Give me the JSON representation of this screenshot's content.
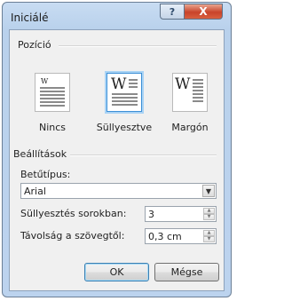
{
  "window": {
    "title": "Iniciálé",
    "help_symbol": "?",
    "close_symbol": "X"
  },
  "position": {
    "group_label": "Pozíció",
    "options": [
      {
        "label": "Nincs",
        "selected": false
      },
      {
        "label": "Süllyesztve",
        "selected": true
      },
      {
        "label": "Margón",
        "selected": false
      }
    ],
    "drop_letter": "W"
  },
  "settings": {
    "group_label": "Beállítások",
    "font_label": "Betűtípus:",
    "font_value": "Arial",
    "lines_label": "Süllyesztés sorokban:",
    "lines_value": "3",
    "distance_label": "Távolság a szövegtől:",
    "distance_value": "0,3 cm"
  },
  "buttons": {
    "ok": "OK",
    "cancel": "Mégse"
  },
  "colors": {
    "selection_border": "#3d8fd6",
    "close_button": "#c9442a",
    "title_bar": "#b9d1ec"
  }
}
